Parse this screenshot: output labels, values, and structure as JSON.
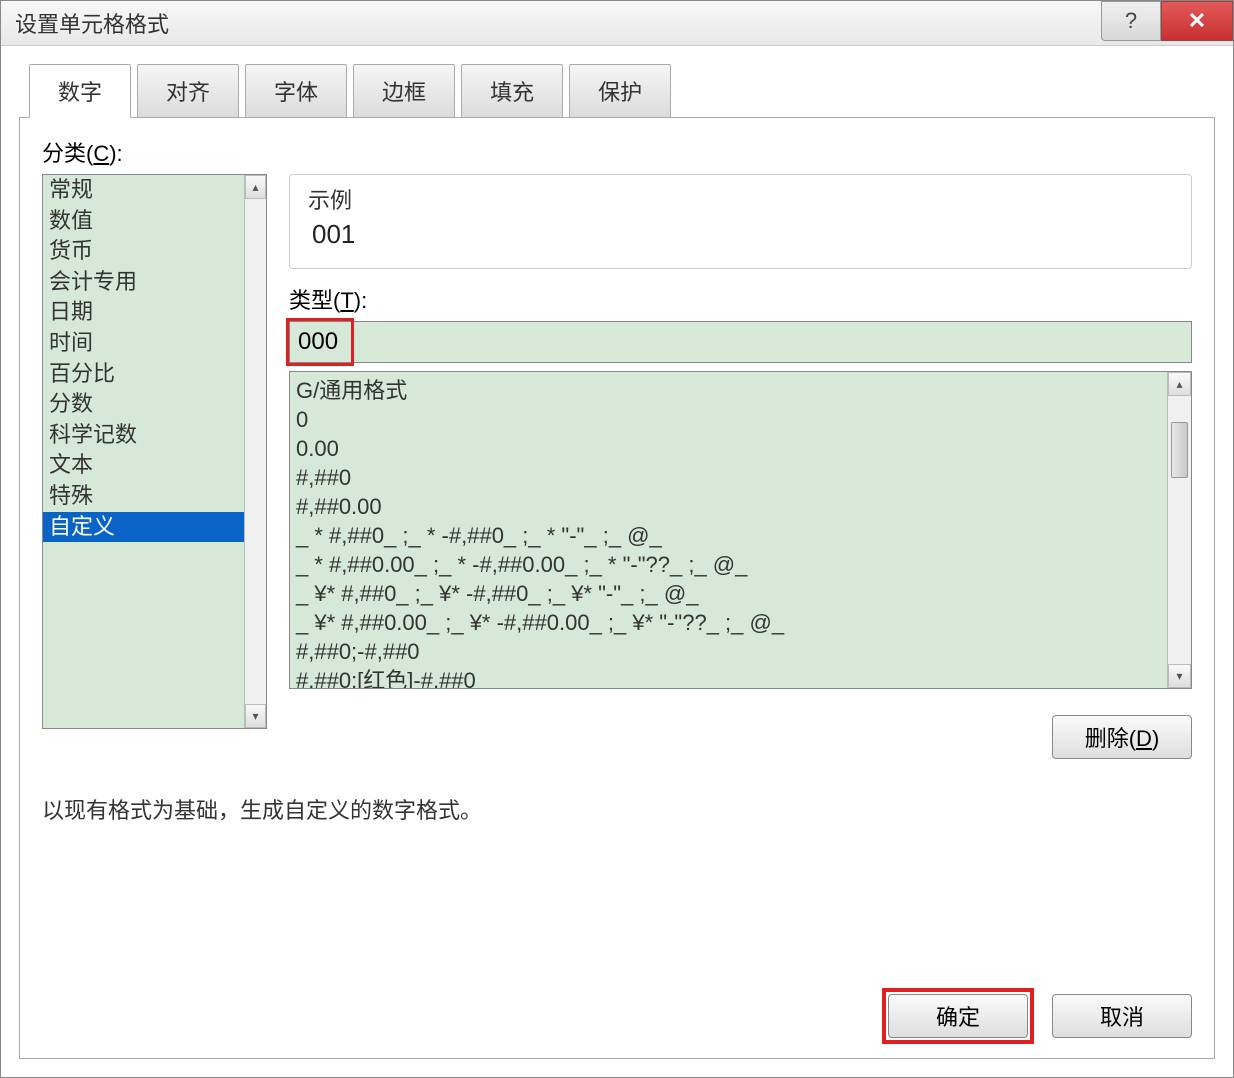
{
  "titlebar": {
    "title": "设置单元格格式"
  },
  "tabs": {
    "items": [
      {
        "label": "数字",
        "active": true
      },
      {
        "label": "对齐",
        "active": false
      },
      {
        "label": "字体",
        "active": false
      },
      {
        "label": "边框",
        "active": false
      },
      {
        "label": "填充",
        "active": false
      },
      {
        "label": "保护",
        "active": false
      }
    ]
  },
  "category": {
    "label_prefix": "分类(",
    "label_key": "C",
    "label_suffix": "):",
    "items": [
      "常规",
      "数值",
      "货币",
      "会计专用",
      "日期",
      "时间",
      "百分比",
      "分数",
      "科学记数",
      "文本",
      "特殊",
      "自定义"
    ],
    "selected_index": 11
  },
  "sample": {
    "label": "示例",
    "value": "001"
  },
  "type": {
    "label_prefix": "类型(",
    "label_key": "T",
    "label_suffix": "):",
    "value": "000"
  },
  "format_list": [
    "G/通用格式",
    "0",
    "0.00",
    "#,##0",
    "#,##0.00",
    "_ * #,##0_ ;_ * -#,##0_ ;_ * \"-\"_ ;_ @_",
    "_ * #,##0.00_ ;_ * -#,##0.00_ ;_ * \"-\"??_ ;_ @_",
    "_ ¥* #,##0_ ;_ ¥* -#,##0_ ;_ ¥* \"-\"_ ;_ @_",
    "_ ¥* #,##0.00_ ;_ ¥* -#,##0.00_ ;_ ¥* \"-\"??_ ;_ @_",
    "#,##0;-#,##0",
    "#,##0;[红色]-#,##0"
  ],
  "buttons": {
    "delete_prefix": "删除(",
    "delete_key": "D",
    "delete_suffix": ")",
    "ok": "确定",
    "cancel": "取消"
  },
  "hint": "以现有格式为基础，生成自定义的数字格式。"
}
